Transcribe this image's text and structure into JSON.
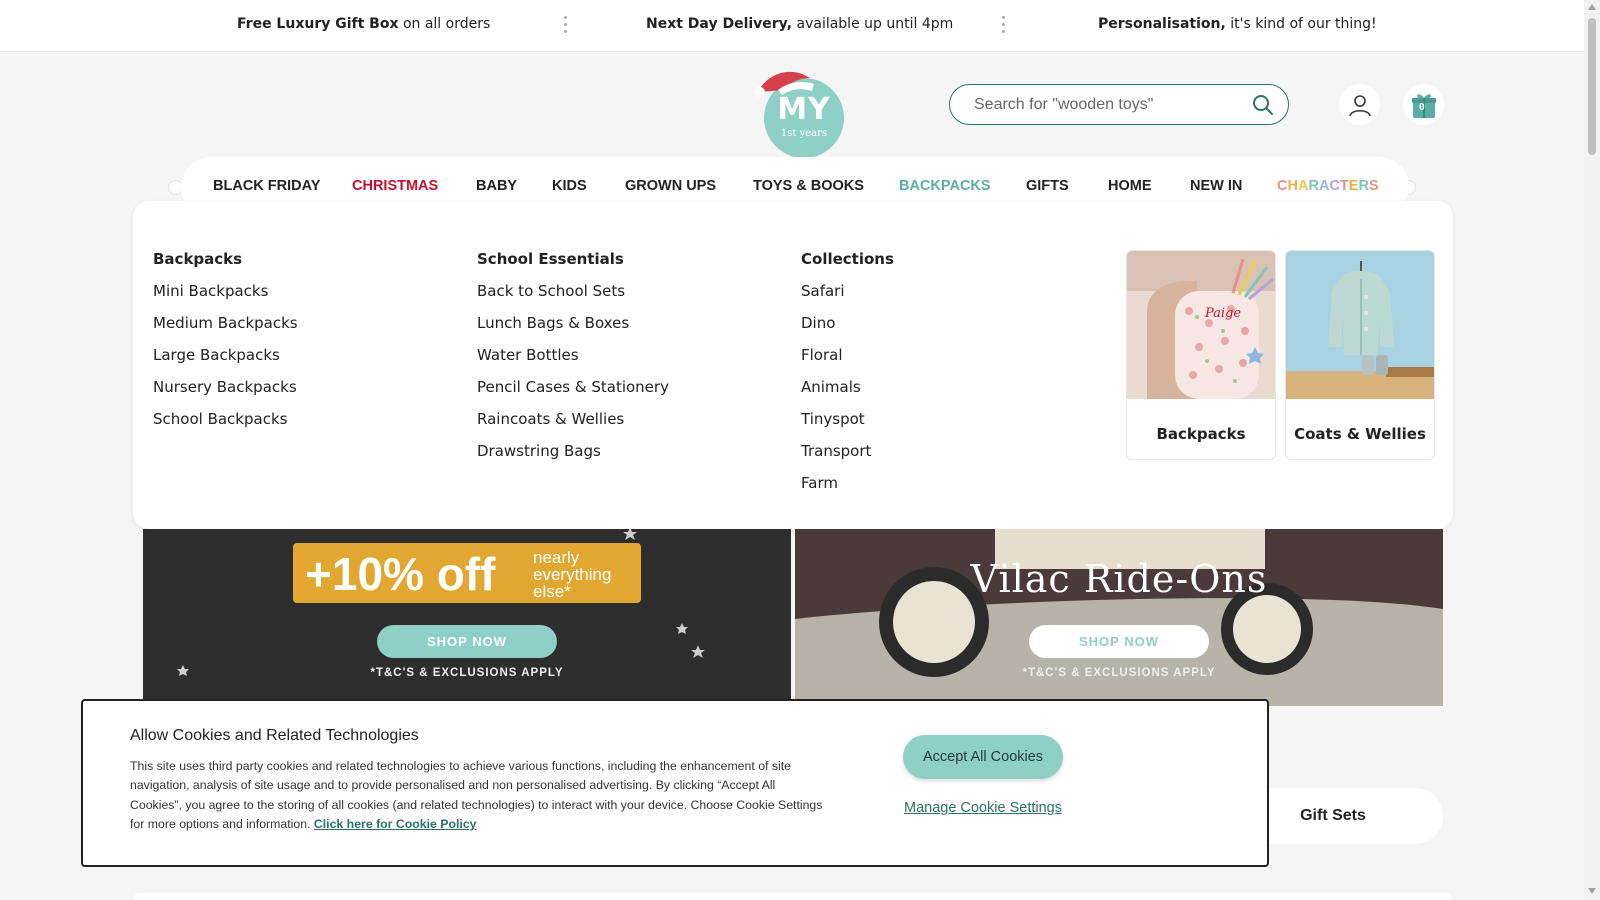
{
  "announcements": [
    {
      "bold": "Free Luxury Gift Box",
      "rest": " on all orders"
    },
    {
      "bold": "Next Day Delivery,",
      "rest": " available up until 4pm"
    },
    {
      "bold": "Personalisation,",
      "rest": " it's kind of our thing!"
    }
  ],
  "logo": {
    "text": "MY",
    "sub": "1st years",
    "alt": "My 1st Years logo"
  },
  "search": {
    "placeholder": "Search for \"wooden toys\""
  },
  "basket": {
    "count": "0"
  },
  "nav": {
    "items": [
      "BLACK FRIDAY",
      "CHRISTMAS",
      "BABY",
      "KIDS",
      "GROWN UPS",
      "TOYS & BOOKS",
      "BACKPACKS",
      "GIFTS",
      "HOME",
      "NEW IN",
      "CHARACTERS"
    ],
    "active": "BACKPACKS",
    "highlight": "CHRISTMAS",
    "characters_colors": [
      "#e88f8a",
      "#e9b04c",
      "#f0c84a",
      "#7ec6b8",
      "#8fb6e0",
      "#b9a0d8",
      "#e88f8a",
      "#e9b04c",
      "#7ec6b8",
      "#e88f8a"
    ]
  },
  "mega": {
    "columns": [
      {
        "heading": "Backpacks",
        "links": [
          "Mini Backpacks",
          "Medium Backpacks",
          "Large Backpacks",
          "Nursery Backpacks",
          "School Backpacks"
        ]
      },
      {
        "heading": "School Essentials",
        "links": [
          "Back to School Sets",
          "Lunch Bags & Boxes",
          "Water Bottles",
          "Pencil Cases & Stationery",
          "Raincoats & Wellies",
          "Drawstring Bags"
        ]
      },
      {
        "heading": "Collections",
        "links": [
          "Safari",
          "Dino",
          "Floral",
          "Animals",
          "Tinyspot",
          "Transport",
          "Farm"
        ]
      }
    ],
    "cards": [
      {
        "label": "Backpacks",
        "backpack_text": "Paige"
      },
      {
        "label": "Coats & Wellies"
      }
    ]
  },
  "banners": {
    "left": {
      "big": "+10% off",
      "small": [
        "nearly",
        "everything",
        "else*"
      ],
      "button": "SHOP NOW",
      "tc": "*T&C'S & EXCLUSIONS APPLY"
    },
    "right": {
      "title": "Vilac Ride-Ons",
      "button": "SHOP NOW",
      "tc": "*T&C'S & EXCLUSIONS APPLY"
    }
  },
  "gift_sets": {
    "label": "Gift Sets"
  },
  "cookie": {
    "title": "Allow Cookies and Related Technologies",
    "text": "This site uses third party cookies and related technologies to achieve various functions, including the enhancement of site navigation, analysis of site usage and to provide personalised and non personalised advertising. By clicking “Accept All Cookies”, you agree to the storing of all cookies (and related technologies) to interact with your device. Choose Cookie Settings for more options and information. ",
    "policy_link": "Click here for Cookie Policy",
    "accept": "Accept All Cookies",
    "manage": "Manage Cookie Settings"
  },
  "colors": {
    "teal": "#8fd0c6",
    "dark_teal": "#2f6f69",
    "red": "#c8102e",
    "gold": "#e1a730"
  }
}
